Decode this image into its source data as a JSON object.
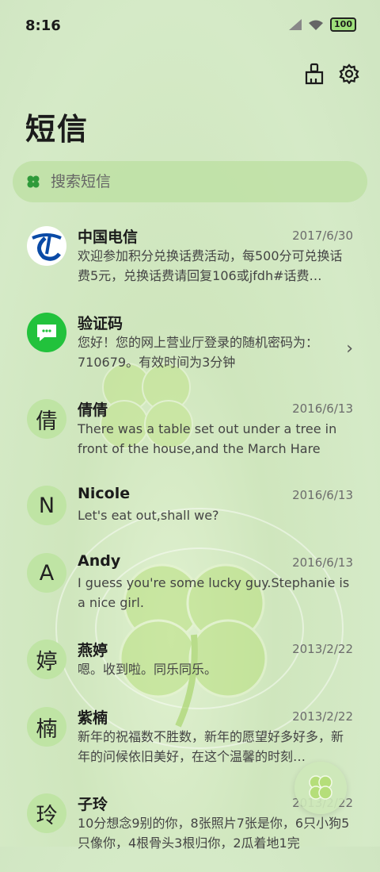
{
  "status": {
    "time": "8:16",
    "battery": "100"
  },
  "header": {
    "title": "短信"
  },
  "search": {
    "placeholder": "搜索短信"
  },
  "conversations": [
    {
      "avatar": "",
      "name": "中国电信",
      "date": "2017/6/30",
      "preview": "欢迎参加积分兑换话费活动，每500分可兑换话费5元，兑换话费请回复106或jfdh#话费…"
    },
    {
      "avatar": "",
      "name": "验证码",
      "date": "",
      "preview": "您好！您的网上营业厅登录的随机密码为：710679。有效时间为3分钟"
    },
    {
      "avatar": "倩",
      "name": "倩倩",
      "date": "2016/6/13",
      "preview": "There was a table set out under a tree in front of the house,and the March Hare an…"
    },
    {
      "avatar": "N",
      "name": "Nicole",
      "date": "2016/6/13",
      "preview": "Let's eat out,shall we?"
    },
    {
      "avatar": "A",
      "name": "Andy",
      "date": "2016/6/13",
      "preview": "I guess you're some lucky guy.Stephanie is a nice girl."
    },
    {
      "avatar": "婷",
      "name": "燕婷",
      "date": "2013/2/22",
      "preview": "嗯。收到啦。同乐同乐。"
    },
    {
      "avatar": "楠",
      "name": "紫楠",
      "date": "2013/2/22",
      "preview": "新年的祝福数不胜数，新年的愿望好多好多，新年的问候依旧美好，在这个温馨的时刻…"
    },
    {
      "avatar": "玲",
      "name": "子玲",
      "date": "2013/2/22",
      "preview": "10分想念9别的你，8张照片7张是你，6只小狗5只像你，4根骨头3根归你，2瓜着地1完"
    }
  ]
}
